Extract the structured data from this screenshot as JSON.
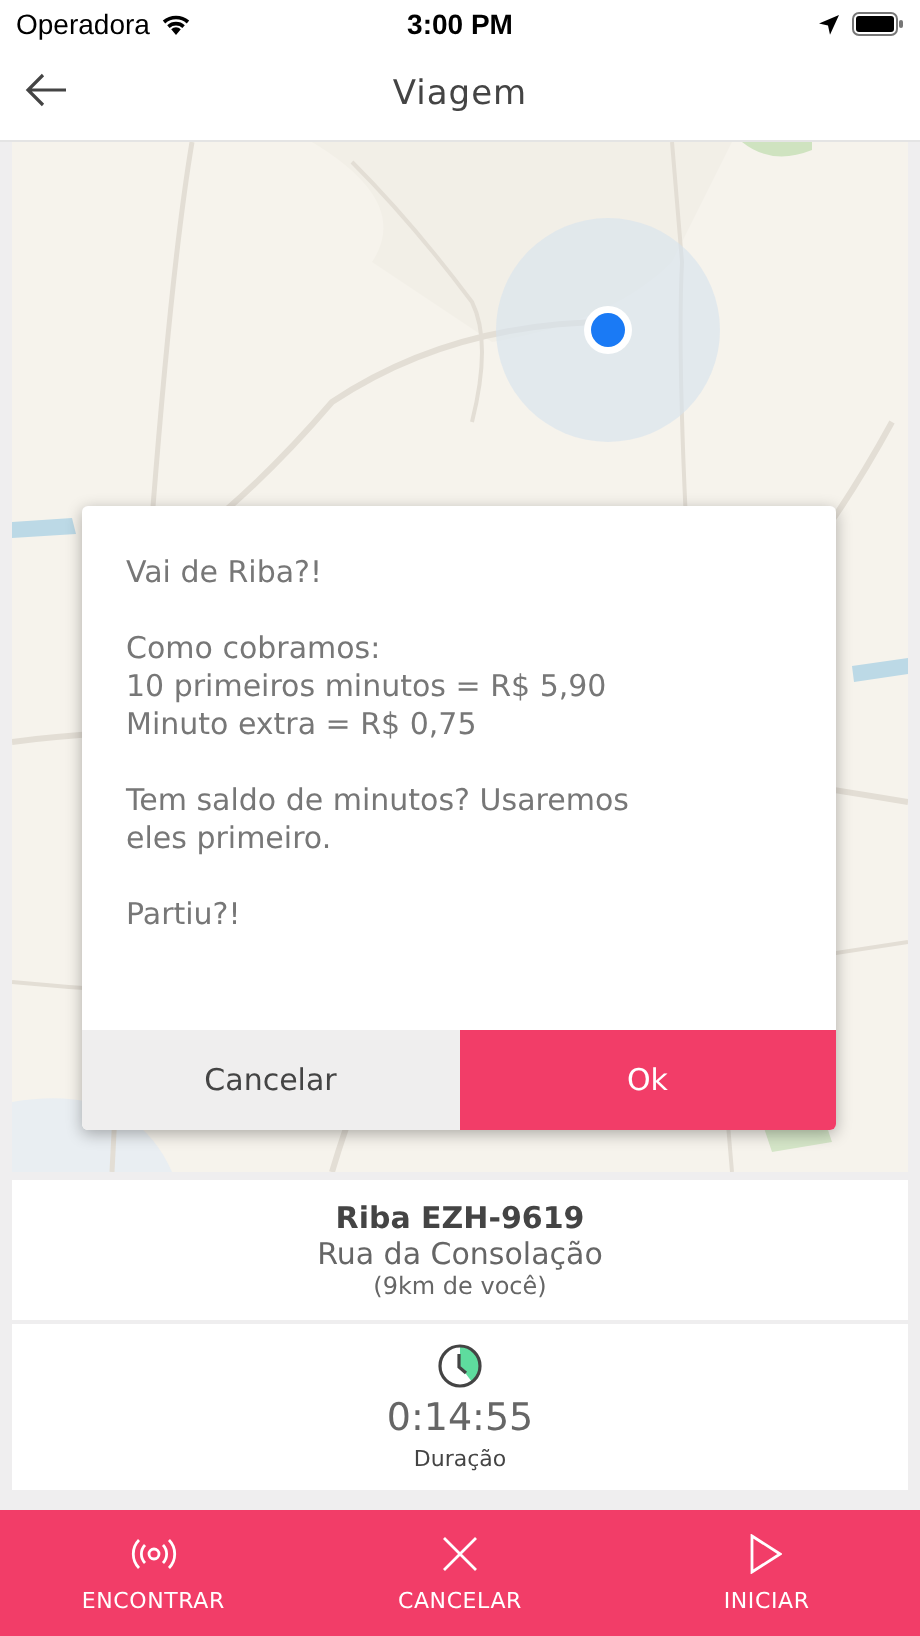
{
  "status_bar": {
    "carrier": "Operadora",
    "time": "3:00 PM"
  },
  "header": {
    "title": "Viagem"
  },
  "dialog": {
    "paragraphs": [
      "Vai de Riba?!",
      "Como cobramos:\n10 primeiros minutos = R$ 5,90\nMinuto extra = R$ 0,75",
      "Tem saldo de minutos? Usaremos eles primeiro.",
      "Partiu?!"
    ],
    "buttons": [
      {
        "label": "Cancelar",
        "kind": "secondary"
      },
      {
        "label": "Ok",
        "kind": "primary"
      }
    ]
  },
  "vehicle": {
    "name": "Riba EZH-9619",
    "street": "Rua da Consolação",
    "distance": "(9km de você)"
  },
  "duration": {
    "time": "0:14:55",
    "label": "Duração"
  },
  "actions": [
    {
      "label": "ENCONTRAR"
    },
    {
      "label": "CANCELAR"
    },
    {
      "label": "INICIAR"
    }
  ]
}
